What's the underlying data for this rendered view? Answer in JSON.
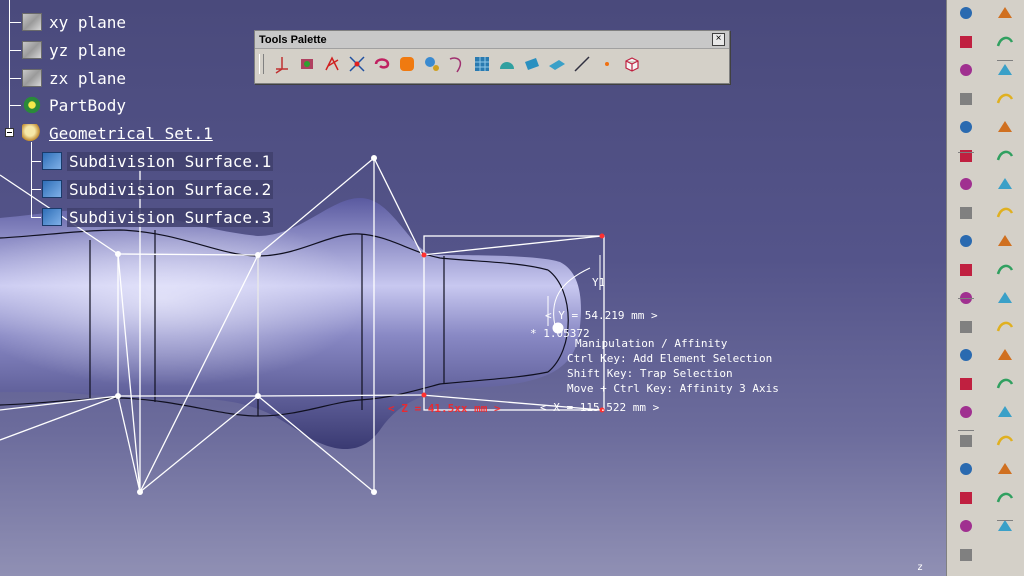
{
  "tree": {
    "items": [
      {
        "label": "xy plane",
        "icon": "plane-icon"
      },
      {
        "label": "yz plane",
        "icon": "plane-icon"
      },
      {
        "label": "zx plane",
        "icon": "plane-icon"
      },
      {
        "label": "PartBody",
        "icon": "partbody-icon"
      },
      {
        "label": "Geometrical Set.1",
        "icon": "geometrical-set-icon"
      },
      {
        "label": "Subdivision Surface.1",
        "icon": "subdivision-surface-icon"
      },
      {
        "label": "Subdivision Surface.2",
        "icon": "subdivision-surface-icon"
      },
      {
        "label": "Subdivision Surface.3",
        "icon": "subdivision-surface-icon"
      }
    ]
  },
  "palette": {
    "title": "Tools Palette",
    "close": "×",
    "tools": [
      "compass-icon",
      "point-cloud-icon",
      "axis-arrows-icon",
      "cursor-node-icon",
      "loop-arrow-icon",
      "orange-shape-icon",
      "sphere-gear-icon",
      "curve-icon",
      "grid-icon",
      "protractor-icon",
      "plane-tool-icon",
      "surface-icon",
      "line-icon",
      "point-icon",
      "box-icon"
    ]
  },
  "readouts": {
    "y": "< Y = 54.219 mm >",
    "x": "< X = 115.522 mm >",
    "z": "< Z = 41.5xx mm >",
    "scale": "* 1.05372",
    "axis_label": "Y1"
  },
  "help": {
    "lines": [
      "Manipulation / Affinity",
      "Ctrl Key: Add Element Selection",
      "Shift Key: Trap Selection",
      "Move + Ctrl Key: Affinity 3 Axis"
    ]
  },
  "colors": {
    "background_top": "#4a4a7c",
    "surface": "#8484c0",
    "cage": "#ffffff",
    "toolbar": "#d4d0c8",
    "dimension_red": "#ff2020"
  },
  "right_toolbar": {
    "tools": [
      "sketch-icon",
      "sphere-icon",
      "select-arrow-icon",
      "cube-icon",
      "list-icon",
      "cube-link-icon",
      "xyz-icon",
      "pointer-edit-icon",
      "point-icon",
      "curve-arrow-icon",
      "swirl-icon",
      "curve-arrow2-icon",
      "orange-curve-icon",
      "yellow-curve-icon",
      "sphere-stripe-icon",
      "grid-face-icon",
      "magnifier-icon",
      "blue-face-icon",
      "angle-icon",
      "split-face-icon",
      "face-icon",
      "stack-icon",
      "sphere-blue-icon",
      "blue-stack-icon",
      "square-icon",
      "layer-icon",
      "cone-icon",
      "cut-icon",
      "cluster-icon",
      "shield-icon",
      "red-sphere-icon",
      "dots-icon",
      "plane-stripe-icon",
      "wire-cube-icon",
      "globe-icon",
      "cross-icon",
      "scissor-icon",
      "eye-icon",
      "target-icon"
    ],
    "corner_text": "z"
  }
}
